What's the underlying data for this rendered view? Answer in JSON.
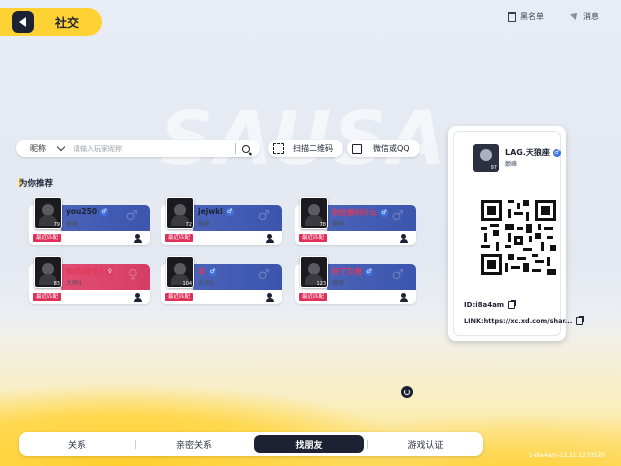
{
  "header": {
    "title": "社交",
    "blacklist": "黑名单",
    "messages": "消息"
  },
  "search": {
    "type_label": "昵称",
    "placeholder": "请输入玩家昵称",
    "scan_label": "扫描二维码",
    "share_label": "微信或QQ"
  },
  "recommend": {
    "title": "为你推荐",
    "cards": [
      {
        "name": "you250",
        "sub": "巅峰",
        "level": "79",
        "gender": "♂",
        "tag": "最近匹配",
        "female": false
      },
      {
        "name": "jejwki",
        "sub": "巅峰",
        "level": "72",
        "gender": "♂",
        "tag": "最近匹配",
        "female": false
      },
      {
        "name": "你在卷叫什么",
        "sub": "巅峰",
        "level": "78",
        "gender": "♂",
        "tag": "最近匹配",
        "female": false
      },
      {
        "name": "快手[校长]",
        "sub": "大师II",
        "level": "83",
        "gender": "♀",
        "tag": "最近匹配",
        "female": true
      },
      {
        "name": "半",
        "sub": "大师II",
        "level": "104",
        "gender": "♂",
        "tag": "最近匹配",
        "female": false
      },
      {
        "name": "好了又卷",
        "sub": "巅峰",
        "level": "123",
        "gender": "♂",
        "tag": "最近匹配",
        "female": false
      }
    ]
  },
  "profile": {
    "name": "LAG.天狼座",
    "gender": "♂",
    "sub": "巅峰",
    "level": "97",
    "id": "ID:i8a4am",
    "link": "LINK:https://xc.xd.com/shar..."
  },
  "tabs": [
    "关系",
    "亲密关系",
    "找朋友",
    "游戏认证"
  ],
  "active_tab": "找朋友",
  "version": "1-i8a4am-13.31.1270520",
  "bg_text": "SAUSA"
}
